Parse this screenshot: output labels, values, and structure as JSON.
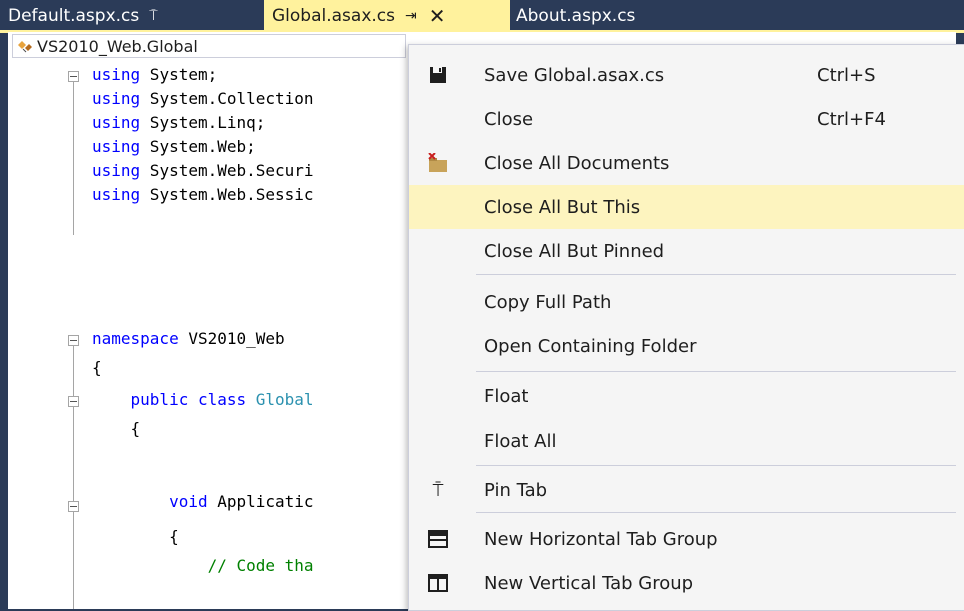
{
  "tabs": {
    "default": {
      "label": "Default.aspx.cs",
      "pin": "⍑"
    },
    "global": {
      "label": "Global.asax.cs",
      "pin": "⇥",
      "close": "✕"
    },
    "about": {
      "label": "About.aspx.cs"
    }
  },
  "navbar": {
    "class_combo": "VS2010_Web.Global"
  },
  "code": {
    "l1_kw": "using",
    "l1_rest": " System;",
    "l2_kw": "using",
    "l2_rest": " System.Collection",
    "l3_kw": "using",
    "l3_rest": " System.Linq;",
    "l4_kw": "using",
    "l4_rest": " System.Web;",
    "l5_kw": "using",
    "l5_rest": " System.Web.Securi",
    "l6_kw": "using",
    "l6_rest": " System.Web.Sessic",
    "l8_kw": "namespace",
    "l8_rest": " VS2010_Web",
    "l9": "{",
    "l10_indent": "    ",
    "l10_kw": "public class",
    "l10_typ": " Global",
    "l11": "    {",
    "l13_indent": "        ",
    "l13_kw": "void",
    "l13_rest": " Applicatic",
    "l14": "        {",
    "l15_indent": "            ",
    "l15_cmt": "// Code tha"
  },
  "menu": {
    "items": [
      {
        "label": "Save Global.asax.cs",
        "shortcut": "Ctrl+S",
        "icon": "save-icon"
      },
      {
        "label": "Close",
        "shortcut": "Ctrl+F4",
        "icon": ""
      },
      {
        "label": "Close All Documents",
        "shortcut": "",
        "icon": "close-all-documents-icon"
      },
      {
        "label": "Close All But This",
        "shortcut": "",
        "icon": ""
      },
      {
        "label": "Close All But Pinned",
        "shortcut": "",
        "icon": ""
      },
      {
        "label": "Copy Full Path",
        "shortcut": "",
        "icon": ""
      },
      {
        "label": "Open Containing Folder",
        "shortcut": "",
        "icon": ""
      },
      {
        "label": "Float",
        "shortcut": "",
        "icon": ""
      },
      {
        "label": "Float All",
        "shortcut": "",
        "icon": ""
      },
      {
        "label": "Pin Tab",
        "shortcut": "",
        "icon": "pin-icon",
        "icon_glyph": "⍑"
      },
      {
        "label": "New Horizontal Tab Group",
        "shortcut": "",
        "icon": "horizontal-tab-group-icon"
      },
      {
        "label": "New Vertical Tab Group",
        "shortcut": "",
        "icon": "vertical-tab-group-icon"
      }
    ]
  },
  "colors": {
    "tab_strip": "#2b3b58",
    "active_tab": "#fff29d",
    "menu_highlight": "#fdf4bf",
    "keyword": "#0000ff",
    "type": "#2b91af",
    "comment": "#008000"
  }
}
